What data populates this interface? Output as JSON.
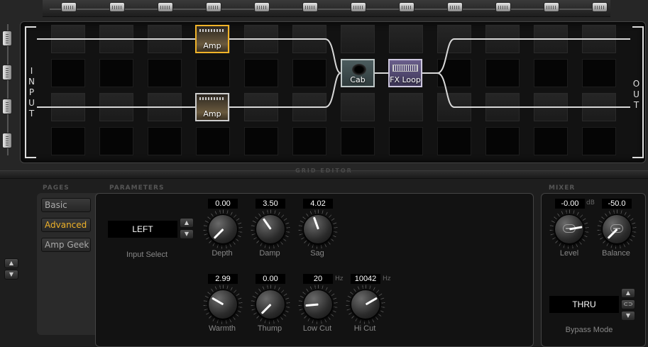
{
  "grid": {
    "input_label": "INPUT",
    "output_label": "OUT",
    "blocks": {
      "amp1": {
        "label": "Amp"
      },
      "amp2": {
        "label": "Amp"
      },
      "cab": {
        "label": "Cab"
      },
      "fxloop": {
        "label": "FX Loop"
      }
    },
    "section_label": "GRID EDITOR"
  },
  "pages": {
    "section_label": "PAGES",
    "items": [
      {
        "label": "Basic",
        "active": false
      },
      {
        "label": "Advanced",
        "active": true
      },
      {
        "label": "Amp Geek",
        "active": false
      }
    ]
  },
  "parameters": {
    "section_label": "PARAMETERS",
    "input_select": {
      "value": "LEFT",
      "label": "Input Select"
    },
    "controls": [
      {
        "label": "Depth",
        "value": "0.00",
        "unit": ""
      },
      {
        "label": "Damp",
        "value": "3.50",
        "unit": ""
      },
      {
        "label": "Sag",
        "value": "4.02",
        "unit": ""
      },
      {
        "label": "Warmth",
        "value": "2.99",
        "unit": ""
      },
      {
        "label": "Thump",
        "value": "0.00",
        "unit": ""
      },
      {
        "label": "Low Cut",
        "value": "20",
        "unit": "Hz"
      },
      {
        "label": "Hi Cut",
        "value": "10042",
        "unit": "Hz"
      }
    ]
  },
  "mixer": {
    "section_label": "MIXER",
    "level": {
      "label": "Level",
      "value": "-0.00",
      "unit": "dB"
    },
    "balance": {
      "label": "Balance",
      "value": "-50.0"
    },
    "bypass": {
      "label": "Bypass Mode",
      "value": "THRU"
    }
  },
  "icons": {
    "arrow_up": "▲",
    "arrow_down": "▼",
    "link": "⊂⊃"
  },
  "colors": {
    "accent": "#f0b329",
    "background": "#1a1a1a",
    "panel": "#121212"
  }
}
